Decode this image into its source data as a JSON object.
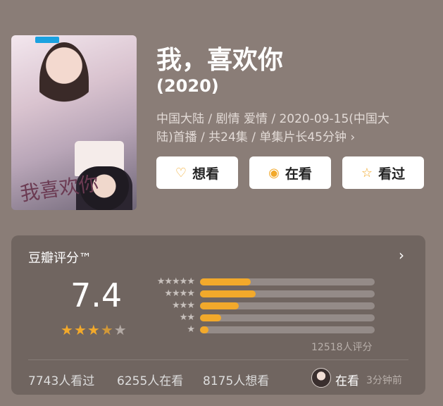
{
  "movie": {
    "title": "我，喜欢你",
    "year": "(2020)",
    "meta_line1": "中国大陆 / 剧情 爱情 / 2020-09-15(中国大",
    "meta_line2": "陆)首播 / 共24集 / 单集片长45分钟",
    "poster_calligraphy": "我喜欢你"
  },
  "actions": {
    "want": "想看",
    "watching": "在看",
    "watched": "看过"
  },
  "rating": {
    "title": "豆瓣评分™",
    "score": "7.4",
    "stars_label": "3.5 stars",
    "rating_count": "12518人评分",
    "distribution": [
      {
        "stars": "★★★★★",
        "percent": 29
      },
      {
        "stars": "★★★★",
        "percent": 32
      },
      {
        "stars": "★★★",
        "percent": 22
      },
      {
        "stars": "★★",
        "percent": 12
      },
      {
        "stars": "★",
        "percent": 5
      }
    ],
    "stats": {
      "watched": "7743人看过",
      "watching": "6255人在看",
      "want": "8175人想看"
    },
    "latest": {
      "status": "在看",
      "time": "3分钟前"
    }
  },
  "colors": {
    "background": "#8a7d77",
    "accent": "#f2a92b"
  }
}
